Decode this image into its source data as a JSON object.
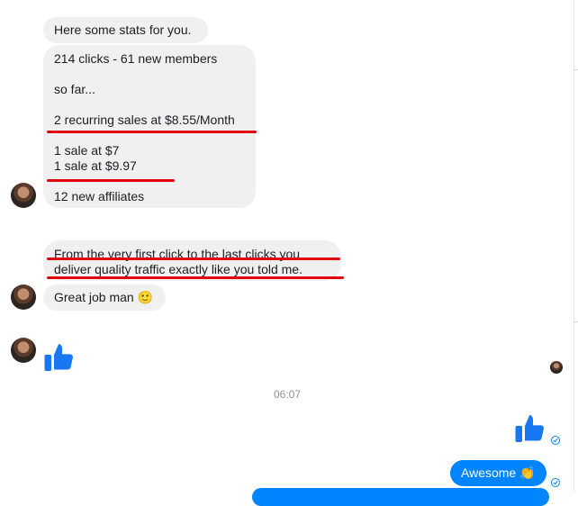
{
  "incoming": {
    "msg1": "Here some stats for you.",
    "msg2_lines": [
      "214 clicks -  61 new members",
      "so far...",
      "2 recurring sales at $8.55/Month",
      "1 sale at $7",
      "1 sale at $9.97",
      "12 new affiliates"
    ],
    "msg3_lines": [
      "From the very first click to the last clicks you",
      "deliver quality traffic exactly like you told me."
    ],
    "msg4_text": "Great job man",
    "msg4_emoji": "🙂"
  },
  "timestamp": "06:07",
  "outgoing": {
    "msg_text": "Awesome",
    "msg_emoji": "👏"
  },
  "icons": {
    "like": "thumbs-up-icon",
    "read": "check-circle-icon"
  },
  "colors": {
    "incoming_bubble": "#f0f0f0",
    "outgoing_bubble": "#0084ff",
    "like_blue": "#1877f2",
    "annotation_red": "#e0000f"
  }
}
